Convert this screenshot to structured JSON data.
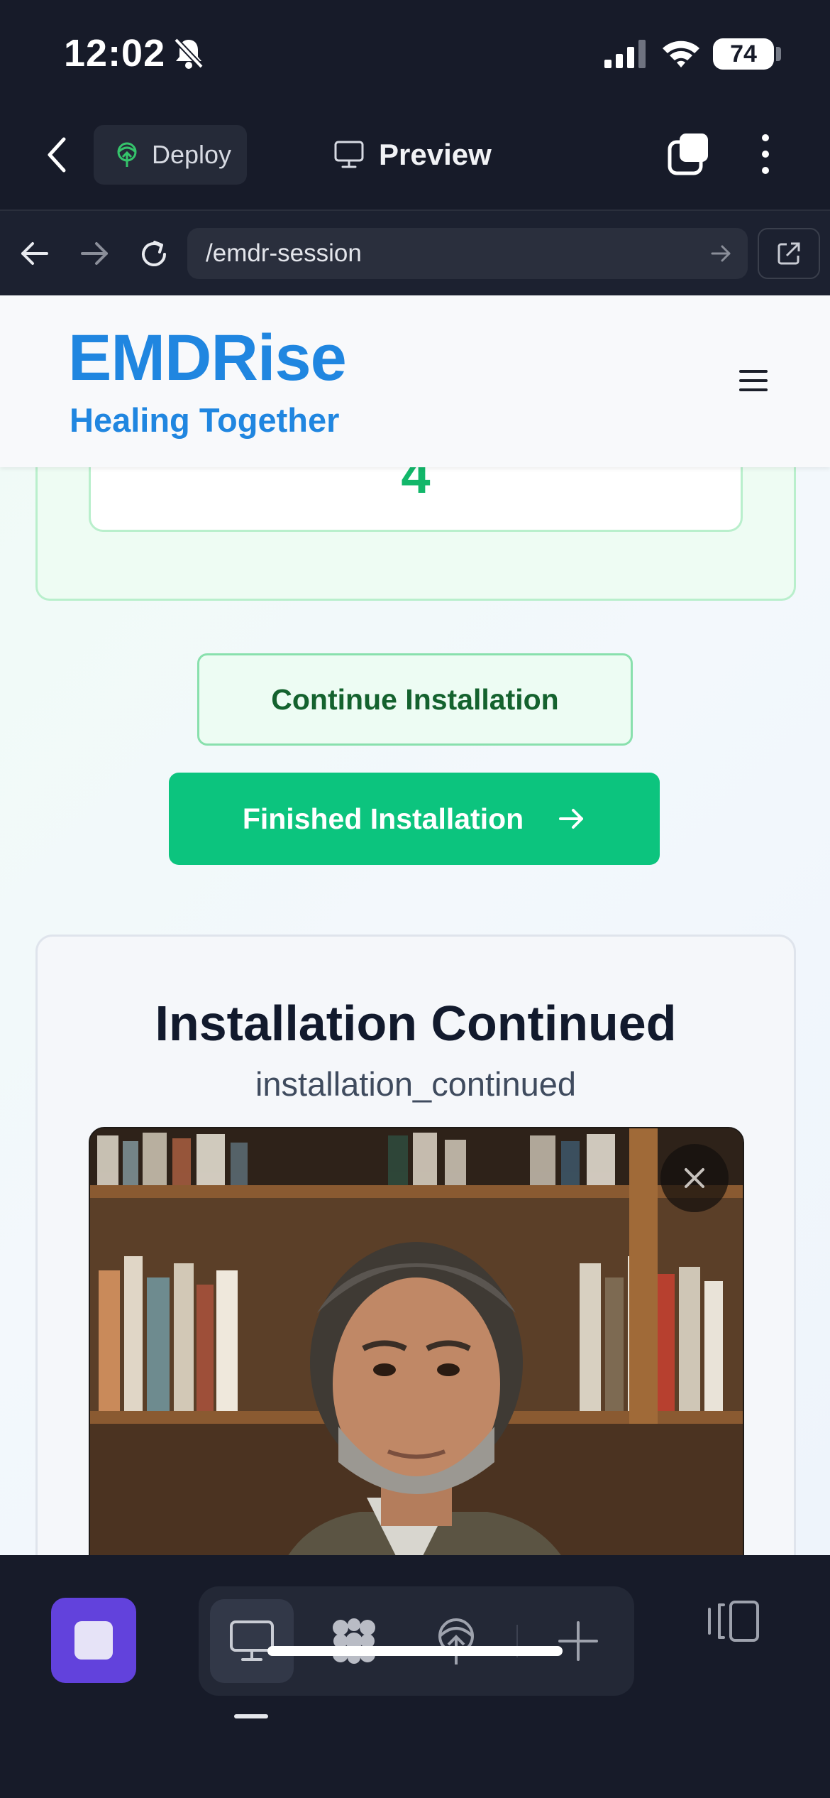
{
  "status_bar": {
    "time": "12:02",
    "battery": "74"
  },
  "top_bar": {
    "deploy_label": "Deploy",
    "preview_label": "Preview"
  },
  "url_bar": {
    "url": "/emdr-session"
  },
  "site": {
    "brand": "EMDRise",
    "tagline": "Healing Together"
  },
  "counter": {
    "value": "4"
  },
  "actions": {
    "continue_label": "Continue Installation",
    "finished_label": "Finished Installation"
  },
  "video_card": {
    "title": "Installation Continued",
    "subtitle": "installation_continued"
  },
  "colors": {
    "brand_blue": "#2086e0",
    "accent_green": "#0cc47e",
    "stop_purple": "#6242dc"
  }
}
